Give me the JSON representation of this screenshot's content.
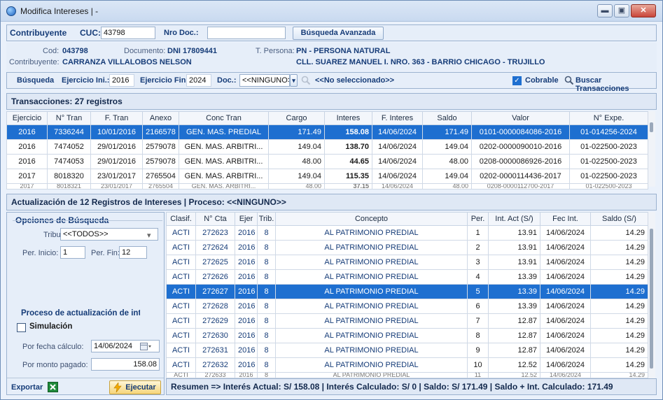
{
  "window": {
    "title": "Modifica Intereses | -",
    "min": "▬",
    "max": "▣",
    "close": "✕"
  },
  "search_row": {
    "contribuyente_label": "Contribuyente",
    "cuc_label": "CUC:",
    "cuc_value": "43798",
    "nro_doc_label": "Nro Doc.:",
    "nro_doc_value": "",
    "advanced_search": "Búsqueda Avanzada"
  },
  "taxpayer": {
    "cod_label": "Cod:",
    "cod_value": "043798",
    "doc_label": "Documento:",
    "doc_value": "DNI  17809441",
    "tpersona_label": "T. Persona:",
    "tpersona_value": "PN - PERSONA NATURAL",
    "contrib_label": "Contribuyente:",
    "contrib_value": "CARRANZA VILLALOBOS NELSON",
    "address_value": "CLL. SUAREZ MANUEL I. NRO. 363 - BARRIO CHICAGO - TRUJILLO"
  },
  "toolbar": {
    "busqueda": "Búsqueda",
    "ej_ini_label": "Ejercicio Ini.:",
    "ej_ini_value": "2016",
    "ej_fin_label": "Ejercicio Fin:",
    "ej_fin_value": "2024",
    "doc_label": "Doc.:",
    "doc_value": "<<NINGUNO>>",
    "no_sel": "<<No seleccionado>>",
    "cobrable": "Cobrable",
    "cobrable_check": "✓",
    "buscar": "Buscar Transacciones",
    "dropdown_icon": "▾"
  },
  "transactions": {
    "title": "Transacciones: 27 registros",
    "headers": [
      "Ejercicio",
      "N° Tran",
      "F. Tran",
      "Anexo",
      "Conc Tran",
      "Cargo",
      "Interes",
      "F. Interes",
      "Saldo",
      "Valor",
      "N° Expe."
    ],
    "rows": [
      [
        "2016",
        "7336244",
        "10/01/2016",
        "2166578",
        "GEN. MAS. PREDIAL",
        "171.49",
        "158.08",
        "14/06/2024",
        "171.49",
        "0101-0000084086-2016",
        "01-014256-2024"
      ],
      [
        "2016",
        "7474052",
        "29/01/2016",
        "2579078",
        "GEN. MAS. ARBITRI...",
        "149.04",
        "138.70",
        "14/06/2024",
        "149.04",
        "0202-0000090010-2016",
        "01-022500-2023"
      ],
      [
        "2016",
        "7474053",
        "29/01/2016",
        "2579078",
        "GEN. MAS. ARBITRI...",
        "48.00",
        "44.65",
        "14/06/2024",
        "48.00",
        "0208-0000086926-2016",
        "01-022500-2023"
      ],
      [
        "2017",
        "8018320",
        "23/01/2017",
        "2765504",
        "GEN. MAS. ARBITRI...",
        "149.04",
        "115.35",
        "14/06/2024",
        "149.04",
        "0202-0000114436-2017",
        "01-022500-2023"
      ]
    ],
    "cut_row": [
      "2017",
      "8018321",
      "23/01/2017",
      "2765504",
      "GEN. MAS. ARBITRI...",
      "48.00",
      "37.15",
      "14/06/2024",
      "48.00",
      "0208-0000112700-2017",
      "01-022500-2023"
    ]
  },
  "update": {
    "title": "Actualización de 12 Registros de Intereses | Proceso: <<NINGUNO>>",
    "options_title": "Opciones de Búsqueda",
    "tributo_label": "Tributo:",
    "tributo_value": "<<TODOS>>",
    "per_inicio_label": "Per. Inicio:",
    "per_inicio_value": "1",
    "per_fin_label": "Per. Fin:",
    "per_fin_value": "12",
    "process_title": "Proceso de actualización de intereses",
    "simulacion": "Simulación",
    "fecha_label": "Por fecha cálculo:",
    "fecha_value": "14/06/2024",
    "monto_label": "Por monto pagado:",
    "monto_value": "158.08",
    "exportar": "Exportar",
    "ejecutar": "Ejecutar",
    "headers": [
      "Clasif.",
      "N° Cta",
      "Ejer",
      "Trib.",
      "Concepto",
      "Per.",
      "Int. Act (S/)",
      "Fec Int.",
      "Saldo (S/)"
    ],
    "rows": [
      [
        "ACTI",
        "272623",
        "2016",
        "8",
        "AL PATRIMONIO PREDIAL",
        "1",
        "13.91",
        "14/06/2024",
        "14.29"
      ],
      [
        "ACTI",
        "272624",
        "2016",
        "8",
        "AL PATRIMONIO PREDIAL",
        "2",
        "13.91",
        "14/06/2024",
        "14.29"
      ],
      [
        "ACTI",
        "272625",
        "2016",
        "8",
        "AL PATRIMONIO PREDIAL",
        "3",
        "13.91",
        "14/06/2024",
        "14.29"
      ],
      [
        "ACTI",
        "272626",
        "2016",
        "8",
        "AL PATRIMONIO PREDIAL",
        "4",
        "13.39",
        "14/06/2024",
        "14.29"
      ],
      [
        "ACTI",
        "272627",
        "2016",
        "8",
        "AL PATRIMONIO PREDIAL",
        "5",
        "13.39",
        "14/06/2024",
        "14.29"
      ],
      [
        "ACTI",
        "272628",
        "2016",
        "8",
        "AL PATRIMONIO PREDIAL",
        "6",
        "13.39",
        "14/06/2024",
        "14.29"
      ],
      [
        "ACTI",
        "272629",
        "2016",
        "8",
        "AL PATRIMONIO PREDIAL",
        "7",
        "12.87",
        "14/06/2024",
        "14.29"
      ],
      [
        "ACTI",
        "272630",
        "2016",
        "8",
        "AL PATRIMONIO PREDIAL",
        "8",
        "12.87",
        "14/06/2024",
        "14.29"
      ],
      [
        "ACTI",
        "272631",
        "2016",
        "8",
        "AL PATRIMONIO PREDIAL",
        "9",
        "12.87",
        "14/06/2024",
        "14.29"
      ],
      [
        "ACTI",
        "272632",
        "2016",
        "8",
        "AL PATRIMONIO PREDIAL",
        "10",
        "12.52",
        "14/06/2024",
        "14.29"
      ]
    ],
    "cut_row": [
      "ACTI",
      "272633",
      "2016",
      "8",
      "AL PATRIMONIO PREDIAL",
      "11",
      "12.52",
      "14/06/2024",
      "14.29"
    ],
    "summary": "Resumen => Interés Actual:  S/ 158.08 | Interés Calculado:  S/ 0 | Saldo: S/ 171.49  | Saldo + Int. Calculado: 171.49"
  },
  "colors": {
    "selection": "#1e6fd0",
    "accent_text": "#163c78",
    "interest_blue": "#1f3fd8"
  }
}
